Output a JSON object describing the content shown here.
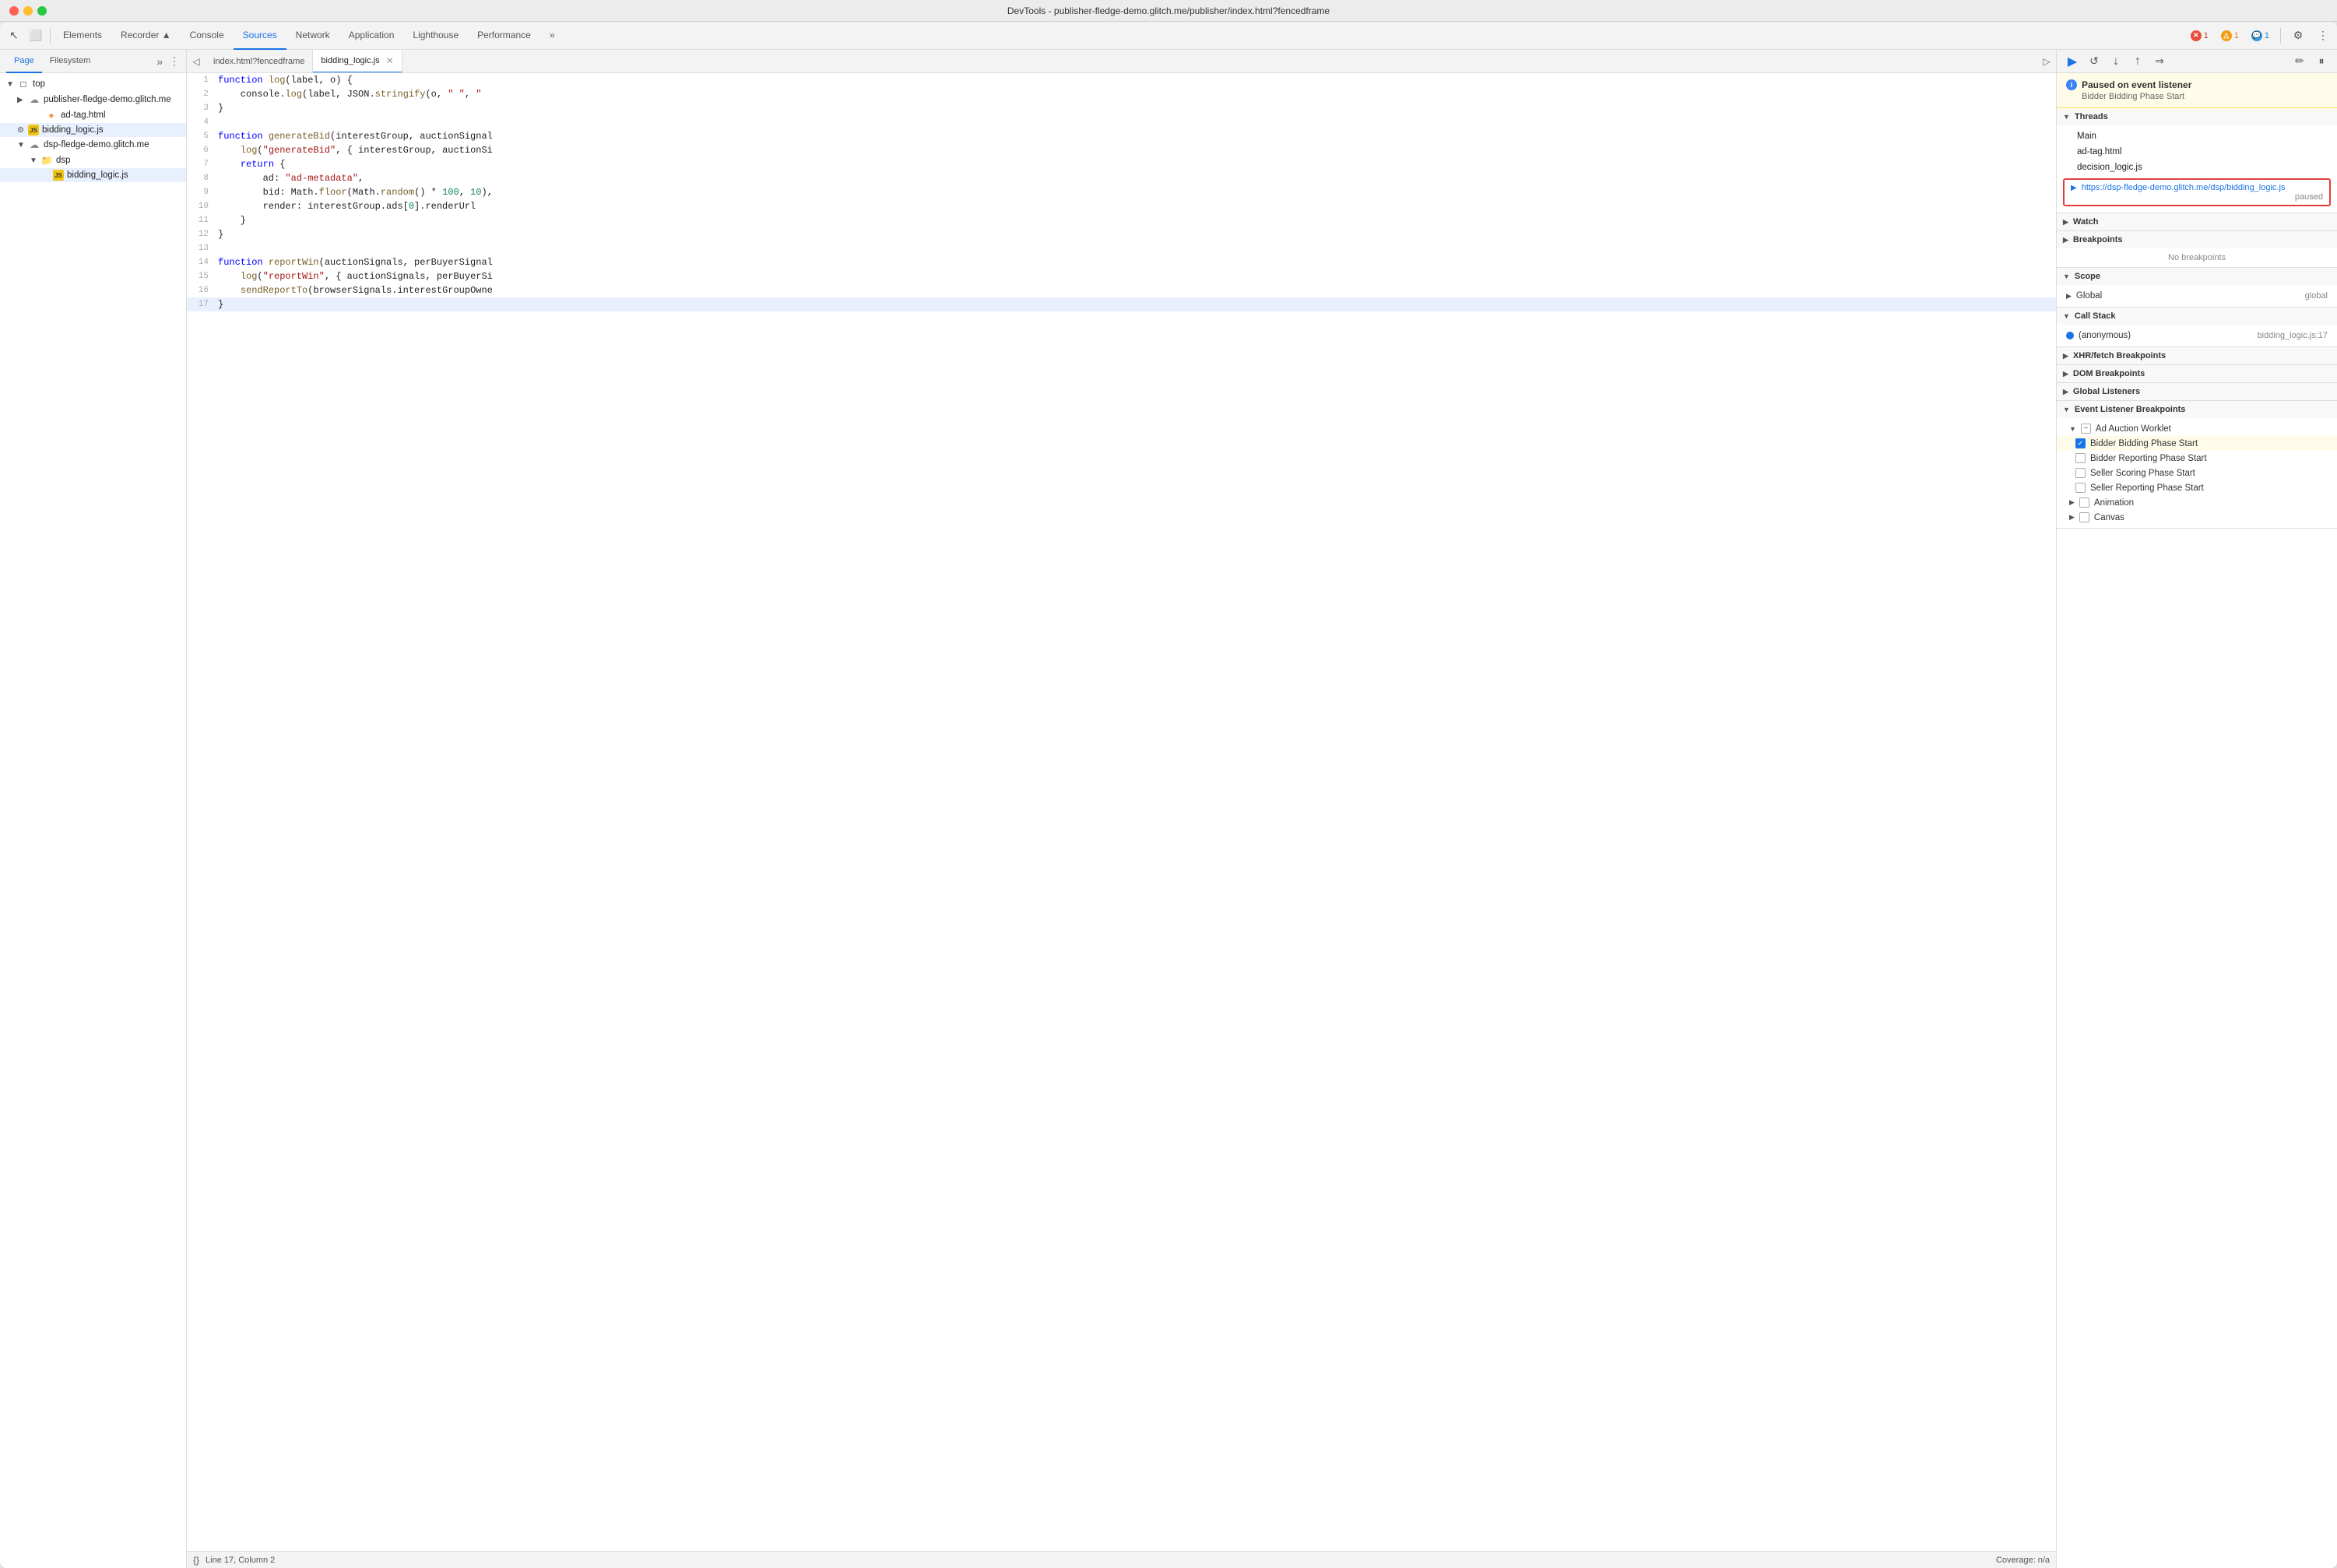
{
  "titlebar": {
    "title": "DevTools - publisher-fledge-demo.glitch.me/publisher/index.html?fencedframe"
  },
  "toolbar": {
    "tabs": [
      {
        "label": "Elements",
        "active": false
      },
      {
        "label": "Recorder ▲",
        "active": false
      },
      {
        "label": "Console",
        "active": false
      },
      {
        "label": "Sources",
        "active": true
      },
      {
        "label": "Network",
        "active": false
      },
      {
        "label": "Application",
        "active": false
      },
      {
        "label": "Lighthouse",
        "active": false
      },
      {
        "label": "Performance",
        "active": false
      }
    ],
    "more_label": "»",
    "badges": {
      "error_count": "1",
      "warn_count": "1",
      "info_count": "1"
    }
  },
  "left_panel": {
    "tabs": [
      {
        "label": "Page",
        "active": true
      },
      {
        "label": "Filesystem",
        "active": false
      }
    ],
    "more_label": "»",
    "tree": [
      {
        "level": 0,
        "icon": "arrow-down",
        "type": "top",
        "label": "top",
        "indent": 0
      },
      {
        "level": 1,
        "icon": "cloud",
        "type": "cloud",
        "label": "publisher-fledge-demo.glitch.me",
        "indent": 16
      },
      {
        "level": 2,
        "icon": "html",
        "type": "html",
        "label": "ad-tag.html",
        "indent": 32
      },
      {
        "level": 1,
        "icon": "js",
        "type": "js",
        "label": "bidding_logic.js",
        "indent": 16,
        "selected": true
      },
      {
        "level": 1,
        "icon": "cloud",
        "type": "cloud",
        "label": "dsp-fledge-demo.glitch.me",
        "indent": 16
      },
      {
        "level": 2,
        "icon": "folder",
        "type": "folder",
        "label": "dsp",
        "indent": 32
      },
      {
        "level": 3,
        "icon": "js",
        "type": "js",
        "label": "bidding_logic.js",
        "indent": 48
      }
    ]
  },
  "editor": {
    "tabs": [
      {
        "label": "index.html?fencedframe",
        "active": false,
        "closeable": false
      },
      {
        "label": "bidding_logic.js",
        "active": true,
        "closeable": true
      }
    ],
    "code_lines": [
      {
        "num": "1",
        "content": "function log(label, o) {"
      },
      {
        "num": "2",
        "content": "    console.log(label, JSON.stringify(o, \" \", \""
      },
      {
        "num": "3",
        "content": "}"
      },
      {
        "num": "4",
        "content": ""
      },
      {
        "num": "5",
        "content": "function generateBid(interestGroup, auctionSignal"
      },
      {
        "num": "6",
        "content": "    log(\"generateBid\", { interestGroup, auctionSi"
      },
      {
        "num": "7",
        "content": "    return {"
      },
      {
        "num": "8",
        "content": "        ad: \"ad-metadata\","
      },
      {
        "num": "9",
        "content": "        bid: Math.floor(Math.random() * 100, 10),"
      },
      {
        "num": "10",
        "content": "        render: interestGroup.ads[0].renderUrl"
      },
      {
        "num": "11",
        "content": "    }"
      },
      {
        "num": "12",
        "content": "}"
      },
      {
        "num": "13",
        "content": ""
      },
      {
        "num": "14",
        "content": "function reportWin(auctionSignals, perBuyerSignal"
      },
      {
        "num": "15",
        "content": "    log(\"reportWin\", { auctionSignals, perBuyerSi"
      },
      {
        "num": "16",
        "content": "    sendReportTo(browserSignals.interestGroupOwne"
      },
      {
        "num": "17",
        "content": "}",
        "highlighted": true
      }
    ],
    "status_bar": {
      "format_icon": "{}",
      "position": "Line 17, Column 2",
      "coverage": "Coverage: n/a"
    }
  },
  "right_panel": {
    "debug_toolbar": {
      "buttons": [
        {
          "icon": "▶",
          "label": "resume",
          "active": true
        },
        {
          "icon": "↺",
          "label": "step-over"
        },
        {
          "icon": "↓",
          "label": "step-into"
        },
        {
          "icon": "↑",
          "label": "step-out"
        },
        {
          "icon": "⇒",
          "label": "step"
        },
        {
          "icon": "✏",
          "label": "edit"
        },
        {
          "icon": "⏸",
          "label": "pause-on-exception"
        }
      ]
    },
    "paused_banner": {
      "title": "Paused on event listener",
      "subtitle": "Bidder Bidding Phase Start"
    },
    "threads": {
      "section_label": "Threads",
      "items": [
        {
          "label": "Main",
          "arrow": false
        },
        {
          "label": "ad-tag.html",
          "arrow": false
        },
        {
          "label": "decision_logic.js",
          "arrow": false
        }
      ],
      "selected_thread": {
        "url": "https://dsp-fledge-demo.glitch.me/dsp/bidding_logic.js",
        "status": "paused"
      }
    },
    "watch": {
      "section_label": "Watch"
    },
    "breakpoints": {
      "section_label": "Breakpoints",
      "empty_message": "No breakpoints"
    },
    "scope": {
      "section_label": "Scope",
      "items": [
        {
          "label": "Global",
          "value": "global"
        }
      ]
    },
    "call_stack": {
      "section_label": "Call Stack",
      "items": [
        {
          "label": "(anonymous)",
          "location": "bidding_logic.js:17"
        }
      ]
    },
    "xhr_breakpoints": {
      "section_label": "XHR/fetch Breakpoints"
    },
    "dom_breakpoints": {
      "section_label": "DOM Breakpoints"
    },
    "global_listeners": {
      "section_label": "Global Listeners"
    },
    "event_listener_breakpoints": {
      "section_label": "Event Listener Breakpoints",
      "groups": [
        {
          "label": "Ad Auction Worklet",
          "expanded": true,
          "partial_check": true,
          "items": [
            {
              "label": "Bidder Bidding Phase Start",
              "checked": true,
              "highlighted": true
            },
            {
              "label": "Bidder Reporting Phase Start",
              "checked": false
            },
            {
              "label": "Seller Scoring Phase Start",
              "checked": false
            },
            {
              "label": "Seller Reporting Phase Start",
              "checked": false
            }
          ]
        },
        {
          "label": "Animation",
          "expanded": false,
          "partial_check": false
        },
        {
          "label": "Canvas",
          "expanded": false,
          "partial_check": false
        }
      ]
    }
  }
}
